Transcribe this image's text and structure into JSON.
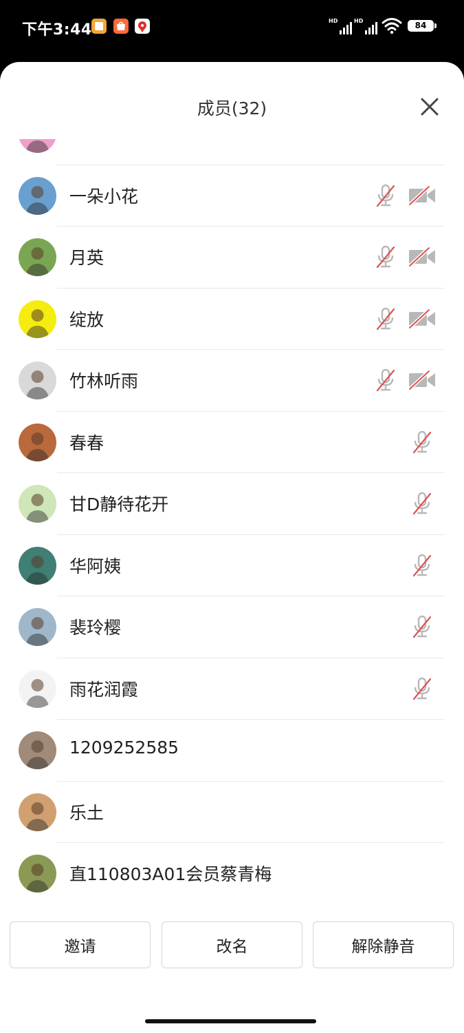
{
  "status_bar": {
    "time": "下午3:44",
    "signal_labels": [
      "HD",
      "HD"
    ],
    "battery": "84"
  },
  "sheet": {
    "title": "成员(32)"
  },
  "members": [
    {
      "name": "",
      "avatar_color": "#f0a0c8",
      "mic_muted": false,
      "cam_off": false
    },
    {
      "name": "一朵小花",
      "avatar_color": "#6aa0cf",
      "mic_muted": true,
      "cam_off": true
    },
    {
      "name": "月英",
      "avatar_color": "#7aa653",
      "mic_muted": true,
      "cam_off": true
    },
    {
      "name": "绽放",
      "avatar_color": "#f5ec10",
      "mic_muted": true,
      "cam_off": true
    },
    {
      "name": "竹林听雨",
      "avatar_color": "#d9d9d9",
      "mic_muted": true,
      "cam_off": true
    },
    {
      "name": "春春",
      "avatar_color": "#b9693b",
      "mic_muted": true,
      "cam_off": false
    },
    {
      "name": "甘D静待花开",
      "avatar_color": "#cfe6b8",
      "mic_muted": true,
      "cam_off": false
    },
    {
      "name": "华阿姨",
      "avatar_color": "#3f7f74",
      "mic_muted": true,
      "cam_off": false
    },
    {
      "name": "裴玲樱",
      "avatar_color": "#9fb7c9",
      "mic_muted": true,
      "cam_off": false
    },
    {
      "name": "雨花润霞",
      "avatar_color": "#f3f3f3",
      "mic_muted": true,
      "cam_off": false
    },
    {
      "name": "1209252585",
      "avatar_color": "#a08a7a",
      "mic_muted": false,
      "cam_off": false
    },
    {
      "name": "乐土",
      "avatar_color": "#d0a070",
      "mic_muted": false,
      "cam_off": false
    },
    {
      "name": "直110803A01会员蔡青梅",
      "avatar_color": "#8a9a55",
      "mic_muted": false,
      "cam_off": false
    }
  ],
  "actions": {
    "invite": "邀请",
    "rename": "改名",
    "unmute": "解除静音"
  },
  "colors": {
    "muted_slash": "#e05050",
    "icon_gray": "#b8b8b8"
  }
}
